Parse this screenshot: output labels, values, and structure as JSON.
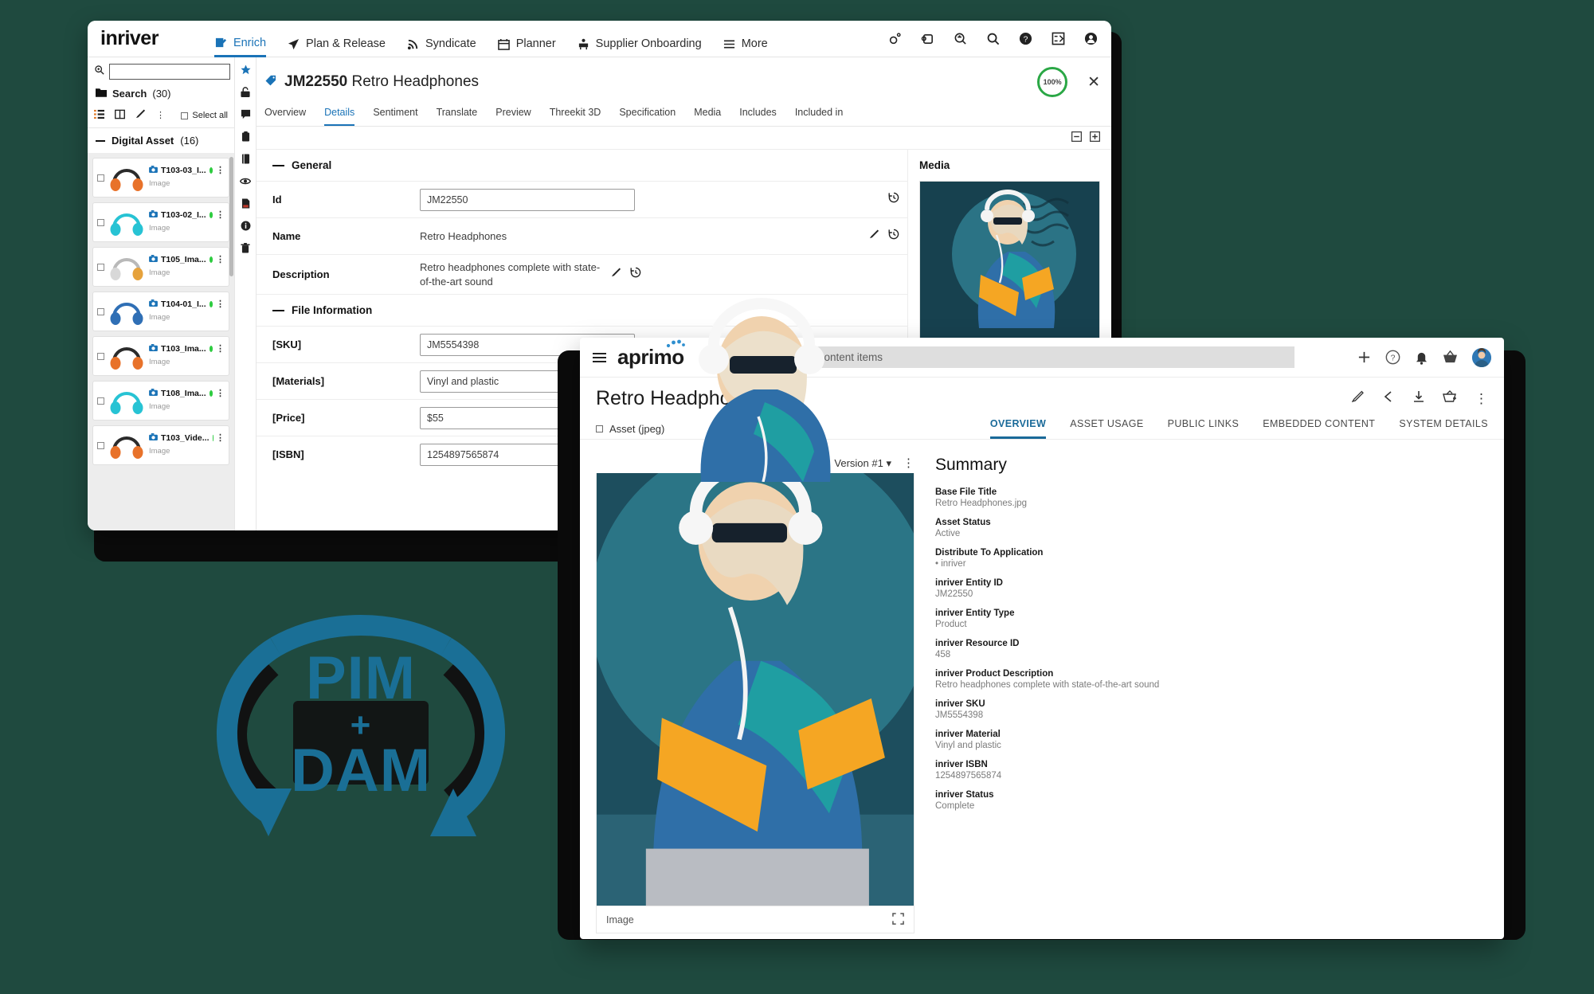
{
  "inriver": {
    "logo": "inriver",
    "nav": [
      {
        "label": "Enrich",
        "icon": "enrich-icon",
        "active": true
      },
      {
        "label": "Plan & Release",
        "icon": "plan-release-icon",
        "active": false
      },
      {
        "label": "Syndicate",
        "icon": "syndicate-icon",
        "active": false
      },
      {
        "label": "Planner",
        "icon": "planner-icon",
        "active": false
      },
      {
        "label": "Supplier Onboarding",
        "icon": "supplier-onboarding-icon",
        "active": false
      },
      {
        "label": "More",
        "icon": "more-menu-icon",
        "active": false
      }
    ],
    "top_right_icons": [
      "settings-gear-icon",
      "workarea-icon",
      "zoom-search-icon",
      "search-icon",
      "help-icon",
      "tasks-icon",
      "user-account-icon"
    ],
    "sidebar": {
      "search_placeholder": "",
      "search_value": "",
      "search_label": "Search",
      "search_count": "(30)",
      "select_all_label": "Select all",
      "toolbar_icons": [
        "list-view-icon",
        "column-view-icon",
        "edit-pen-icon",
        "overflow-menu-icon"
      ],
      "group_label": "Digital Asset",
      "group_count": "(16)",
      "assets": [
        {
          "title": "T103-03_I...",
          "type": "Image",
          "color": "#e8722a",
          "status_color": "#2ecc40"
        },
        {
          "title": "T103-02_I...",
          "type": "Image",
          "color": "#27c3d4",
          "status_color": "#2ecc40"
        },
        {
          "title": "T105_Ima...",
          "type": "Image",
          "color": "#e6a23c",
          "status_color": "#2ecc40"
        },
        {
          "title": "T104-01_I...",
          "type": "Image",
          "color": "#2f6fb5",
          "status_color": "#2ecc40"
        },
        {
          "title": "T103_Ima...",
          "type": "Image",
          "color": "#e8722a",
          "status_color": "#2ecc40"
        },
        {
          "title": "T108_Ima...",
          "type": "Image",
          "color": "#27c3d4",
          "status_color": "#2ecc40"
        },
        {
          "title": "T103_Vide...",
          "type": "Image",
          "color": "#e8722a",
          "status_color": "#2ecc40"
        }
      ]
    },
    "rail_icons": [
      "favorite-star-icon",
      "lock-icon",
      "comment-icon",
      "clipboard-icon",
      "book-icon",
      "eye-icon",
      "pdf-icon",
      "info-icon",
      "trash-icon"
    ],
    "entity": {
      "id": "JM22550",
      "name": "Retro Headphones",
      "completeness": "100%",
      "tag_icon": "tag-icon",
      "back_icon": "chevron-left-icon",
      "star_icon": "star-icon",
      "close_icon": "close-icon",
      "collapse_icon": "collapse-all-icon",
      "expand_icon": "expand-all-icon"
    },
    "tabs": [
      {
        "label": "Overview",
        "active": false
      },
      {
        "label": "Details",
        "active": true
      },
      {
        "label": "Sentiment",
        "active": false
      },
      {
        "label": "Translate",
        "active": false
      },
      {
        "label": "Preview",
        "active": false
      },
      {
        "label": "Threekit 3D",
        "active": false
      },
      {
        "label": "Specification",
        "active": false
      },
      {
        "label": "Media",
        "active": false
      },
      {
        "label": "Includes",
        "active": false
      },
      {
        "label": "Included in",
        "active": false
      }
    ],
    "sections": [
      {
        "title": "General",
        "fields": [
          {
            "label": "Id",
            "value": "JM22550",
            "input": true,
            "actions": [
              "history-icon"
            ]
          },
          {
            "label": "Name",
            "value": "Retro Headphones",
            "input": false,
            "actions": [
              "edit-pen-icon",
              "history-icon"
            ]
          },
          {
            "label": "Description",
            "value": "Retro headphones complete with state-of-the-art sound",
            "input": false,
            "actions": [
              "edit-pen-icon",
              "history-icon"
            ]
          }
        ]
      },
      {
        "title": "File Information",
        "fields": [
          {
            "label": "[SKU]",
            "value": "JM5554398",
            "input": true,
            "actions": []
          },
          {
            "label": "[Materials]",
            "value": "Vinyl and plastic",
            "input": true,
            "actions": []
          },
          {
            "label": "[Price]",
            "value": "$55",
            "input": true,
            "actions": []
          },
          {
            "label": "[ISBN]",
            "value": "1254897565874",
            "input": true,
            "actions": []
          }
        ]
      }
    ],
    "media_panel_title": "Media"
  },
  "aprimo": {
    "logo": "aprimo",
    "search_placeholder": "Search for content items",
    "top_icons": [
      "add-icon",
      "help-icon",
      "notifications-bell-icon",
      "basket-icon",
      "user-avatar"
    ],
    "title": "Retro Headphones.jpg",
    "title_actions": [
      "edit-pen-icon",
      "share-icon",
      "download-icon",
      "add-to-basket-icon",
      "overflow-menu-icon"
    ],
    "asset_type": "Asset (jpeg)",
    "asset_type_icon": "asset-checkbox-icon",
    "tabs": [
      {
        "label": "OVERVIEW",
        "active": true
      },
      {
        "label": "ASSET USAGE",
        "active": false
      },
      {
        "label": "PUBLIC LINKS",
        "active": false
      },
      {
        "label": "EMBEDDED CONTENT",
        "active": false
      },
      {
        "label": "SYSTEM DETAILS",
        "active": false
      }
    ],
    "preview": {
      "version_label": "Version #1",
      "version_caret": "chevron-down-icon",
      "overflow": "overflow-menu-icon",
      "footer_label": "Image",
      "fullscreen_icon": "fullscreen-icon"
    },
    "summary_title": "Summary",
    "summary": [
      {
        "key": "Base File Title",
        "value": "Retro Headphones.jpg"
      },
      {
        "key": "Asset Status",
        "value": "Active"
      },
      {
        "key": "Distribute To Application",
        "value": "• inriver"
      },
      {
        "key": "inriver Entity ID",
        "value": "JM22550"
      },
      {
        "key": "inriver Entity Type",
        "value": "Product"
      },
      {
        "key": "inriver Resource ID",
        "value": "458"
      },
      {
        "key": "inriver Product Description",
        "value": "Retro headphones complete with state-of-the-art sound"
      },
      {
        "key": "inriver SKU",
        "value": "JM5554398"
      },
      {
        "key": "inriver Material",
        "value": "Vinyl and plastic"
      },
      {
        "key": "inriver ISBN",
        "value": "1254897565874"
      },
      {
        "key": "inriver Status",
        "value": "Complete"
      }
    ]
  },
  "badge": {
    "line1": "PIM",
    "plus": "+",
    "line2": "DAM",
    "color": "#1a6f96"
  }
}
